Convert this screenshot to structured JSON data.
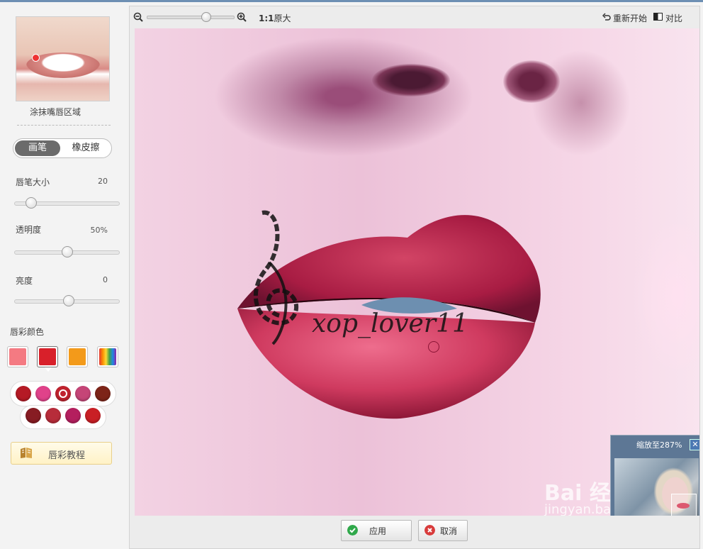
{
  "left_panel": {
    "caption": "涂抹嘴唇区域",
    "mode_tabs": [
      "画笔",
      "橡皮擦"
    ],
    "sliders": [
      {
        "label": "唇笔大小",
        "value": "20",
        "level": 0.12
      },
      {
        "label": "透明度",
        "value": "50%",
        "level": 0.5
      },
      {
        "label": "亮度",
        "value": "0",
        "level": 0.52
      }
    ],
    "color_section_label": "唇彩颜色",
    "color_tabs": [
      "#f47a82",
      "#d8202a",
      "#f39a1a",
      "rainbow"
    ],
    "palette_row1": [
      "#b51a25",
      "#e0428a",
      "#c0222e",
      "#c54577",
      "#7d2418"
    ],
    "palette_row2": [
      "#871c23",
      "#b72c3a",
      "#b41f5e",
      "#c91f25"
    ],
    "tutorial_label": "唇彩教程"
  },
  "toolbar": {
    "ratio_bold": "1:1",
    "ratio_text": "原大",
    "reset_label": "重新开始",
    "compare_label": "对比"
  },
  "canvas": {
    "signature": "xop_lover11",
    "navigator_title": "缩放至287%",
    "navigator_close": "✕",
    "watermark": "Bai 经验",
    "watermark_url": "jingyan.baidu.com"
  },
  "footer": {
    "apply_label": "应用",
    "cancel_label": "取消"
  }
}
